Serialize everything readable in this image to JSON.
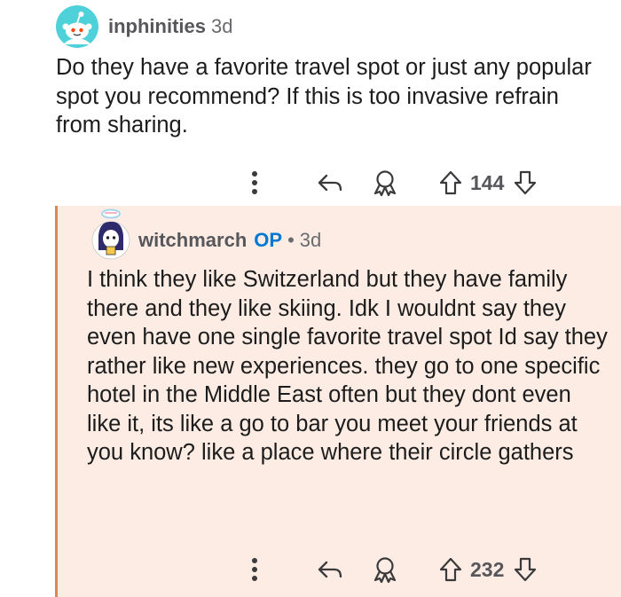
{
  "comments": [
    {
      "author": "inphinities",
      "age": "3d",
      "body": "Do they have a favorite travel spot or just any popular spot you recommend? If this is too invasive refrain from sharing.",
      "score": "144"
    },
    {
      "author": "witchmarch",
      "op_badge": "OP",
      "separator": "•",
      "age": "3d",
      "body": "I think they like Switzerland but they have family there and they like skiing. Idk I wouldnt say they even have one single favorite travel spot Id say they rather like new experiences. they go to one specific hotel in the Middle East often but they dont even like it, its like a go to bar you meet your friends at you know? like a place where their circle gathers",
      "score": "232"
    }
  ],
  "icons": {
    "more": "more-options-icon",
    "reply": "reply-icon",
    "award": "award-icon",
    "upvote": "upvote-icon",
    "downvote": "downvote-icon"
  },
  "colors": {
    "op_highlight_bg": "#fcece4",
    "op_thread_line": "#e0874f",
    "op_badge": "#0079d3",
    "meta_text": "#57575b",
    "body_text": "#1c1c1c"
  }
}
